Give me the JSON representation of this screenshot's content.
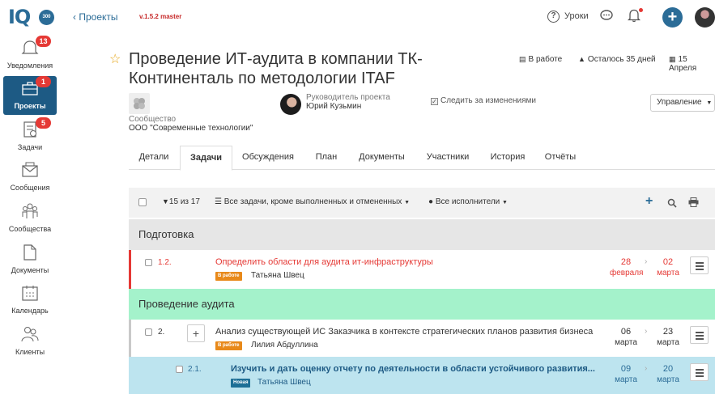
{
  "topbar": {
    "logo_text": "IQ",
    "logo_badge": "300",
    "back_link": "Проекты",
    "version": "v.1.5.2 master",
    "lessons_label": "Уроки",
    "icons": [
      "help-circle-icon",
      "chat-icon",
      "bell-icon",
      "plus-icon",
      "user-avatar"
    ]
  },
  "sidebar": {
    "items": [
      {
        "label": "Уведомления",
        "badge": "13",
        "icon": "bell-icon"
      },
      {
        "label": "Проекты",
        "badge": "1",
        "icon": "briefcase-icon",
        "active": true
      },
      {
        "label": "Задачи",
        "badge": "5",
        "icon": "tasks-icon"
      },
      {
        "label": "Сообщения",
        "badge": "",
        "icon": "envelope-icon"
      },
      {
        "label": "Сообщества",
        "badge": "",
        "icon": "people-icon"
      },
      {
        "label": "Документы",
        "badge": "",
        "icon": "document-icon"
      },
      {
        "label": "Календарь",
        "badge": "",
        "icon": "calendar-icon"
      },
      {
        "label": "Клиенты",
        "badge": "",
        "icon": "clients-icon"
      }
    ]
  },
  "project": {
    "title": "Проведение ИТ-аудита в компании ТК-Континенталь по методологии ITAF",
    "status": "В работе",
    "remaining": "Осталось 35 дней",
    "deadline": "15 Апреля",
    "community_label": "Сообщество",
    "community_name": "ООО \"Современные технологии\"",
    "manager_label": "Руководитель проекта",
    "manager_name": "Юрий Кузьмин",
    "follow_label": "Следить за изменениями",
    "manage_label": "Управление"
  },
  "tabs": [
    "Детали",
    "Задачи",
    "Обсуждения",
    "План",
    "Документы",
    "Участники",
    "История",
    "Отчёты"
  ],
  "active_tab": "Задачи",
  "toolbar": {
    "count": "15 из 17",
    "filter": "Все задачи, кроме выполненных и отмененных",
    "executors": "Все исполнители"
  },
  "sections": [
    {
      "name": "Подготовка"
    },
    {
      "name": "Проведение аудита"
    }
  ],
  "tasks": [
    {
      "number": "1.2.",
      "title": "Определить области для аудита ит-инфраструктуры",
      "status": "В работе",
      "assignee": "Татьяна Швец",
      "start_day": "28",
      "start_month": "февраля",
      "end_day": "02",
      "end_month": "марта",
      "title_color": "#e53935",
      "date_color": "#e53935",
      "status_color": "#e8891a"
    },
    {
      "number": "2.",
      "title": "Анализ существующей ИС Заказчика в контексте стратегических планов развития бизнеса",
      "status": "В работе",
      "assignee": "Лилия Абдуллина",
      "start_day": "06",
      "start_month": "марта",
      "end_day": "23",
      "end_month": "марта",
      "title_color": "#333333",
      "date_color": "#333333",
      "status_color": "#e8891a"
    },
    {
      "number": "2.1.",
      "title": "Изучить и дать оценку отчету по деятельности в области устойчивого развития...",
      "status": "Новая",
      "assignee": "Татьяна Швец",
      "start_day": "09",
      "start_month": "марта",
      "end_day": "20",
      "end_month": "марта",
      "title_color": "#1d5a84",
      "date_color": "#2b6c97",
      "status_color": "#1d6f96"
    }
  ],
  "colors": {
    "brand": "#2b6c97",
    "active_sidebar": "#1d5a84",
    "badge": "#e53935",
    "overdue": "#e53935",
    "section_audit": "#a4f2cb",
    "row_highlight": "#bde4ef"
  }
}
